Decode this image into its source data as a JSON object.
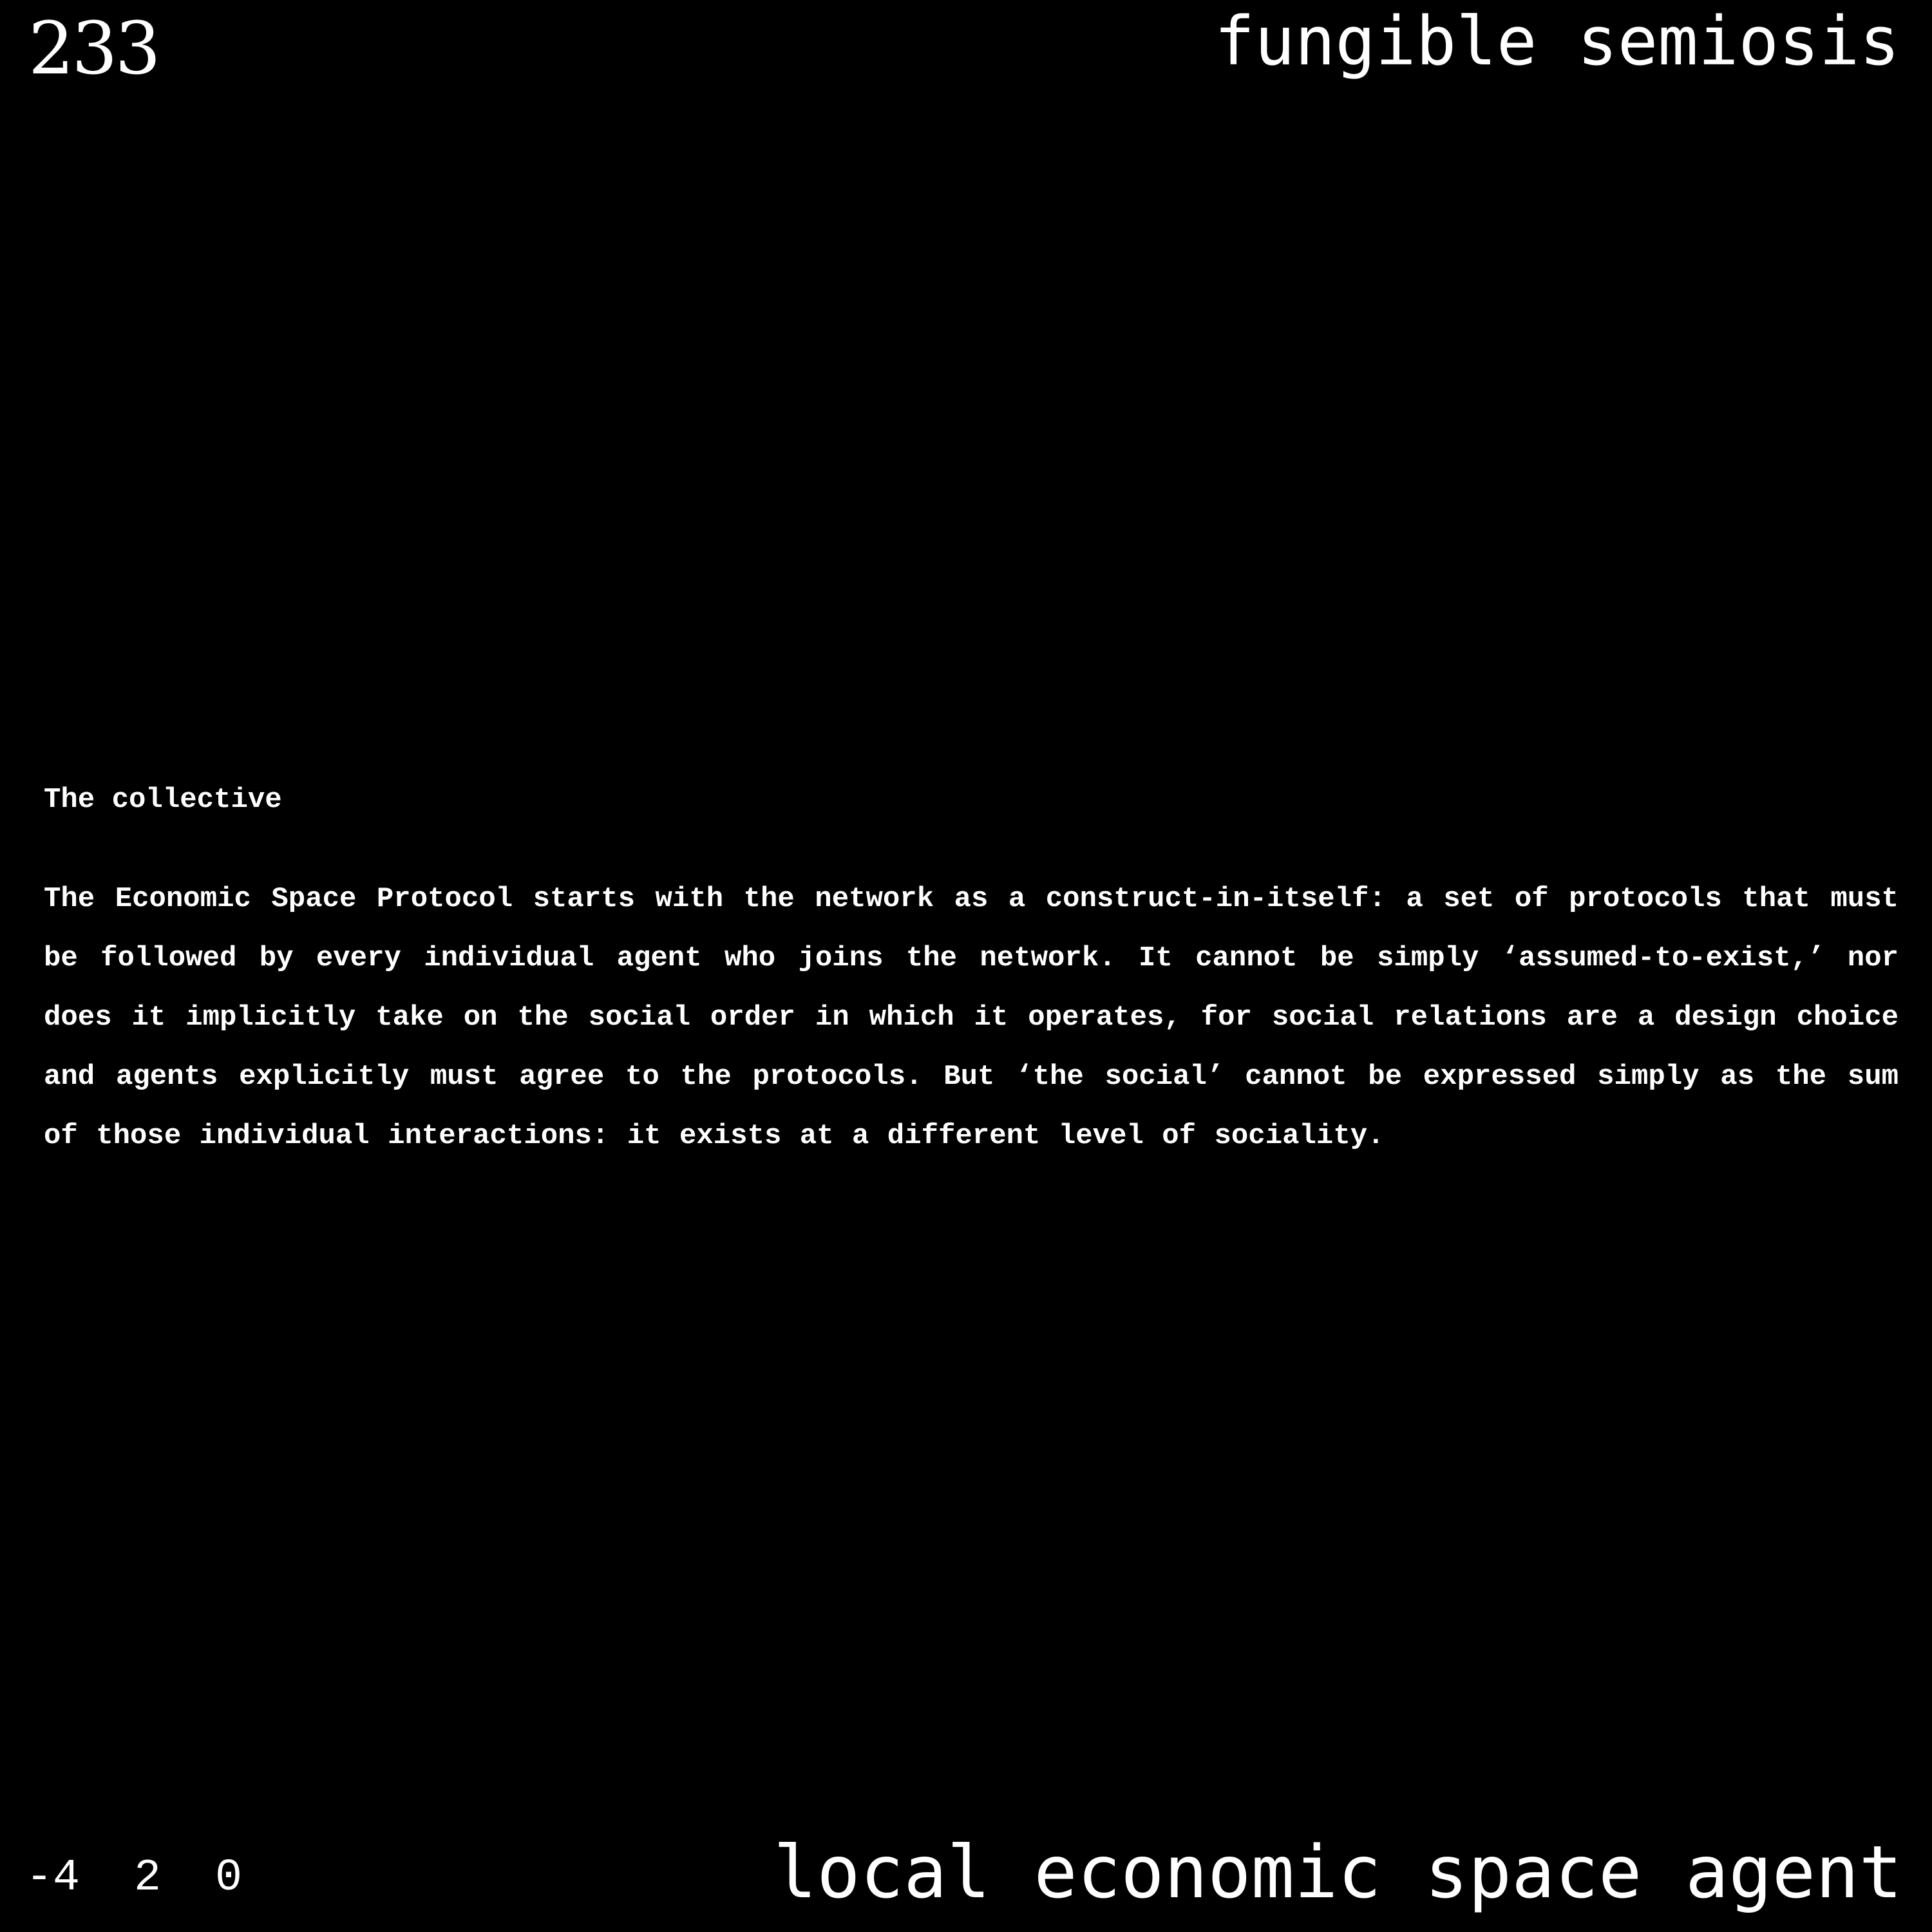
{
  "header": {
    "page_number": "233",
    "series_title": "fungible semiosis"
  },
  "section": {
    "heading": "The collective",
    "body": "The Economic Space Protocol starts with the network as a construct-in-itself: a set of protocols that must be followed by every individual agent who joins the network. It cannot be simply ‘assumed-to-exist,’ nor does it implicitly take on the social order in which it operates, for social relations are a design choice and agents explicitly must agree to the protocols. But ‘the social’ cannot be expressed simply as the sum of those individual interactions: it exists at a different level of sociality."
  },
  "footer": {
    "coordinates": "-4 2 0",
    "agent_label": "local economic space agent"
  },
  "colors": {
    "background": "#000000",
    "text": "#ffffff"
  }
}
